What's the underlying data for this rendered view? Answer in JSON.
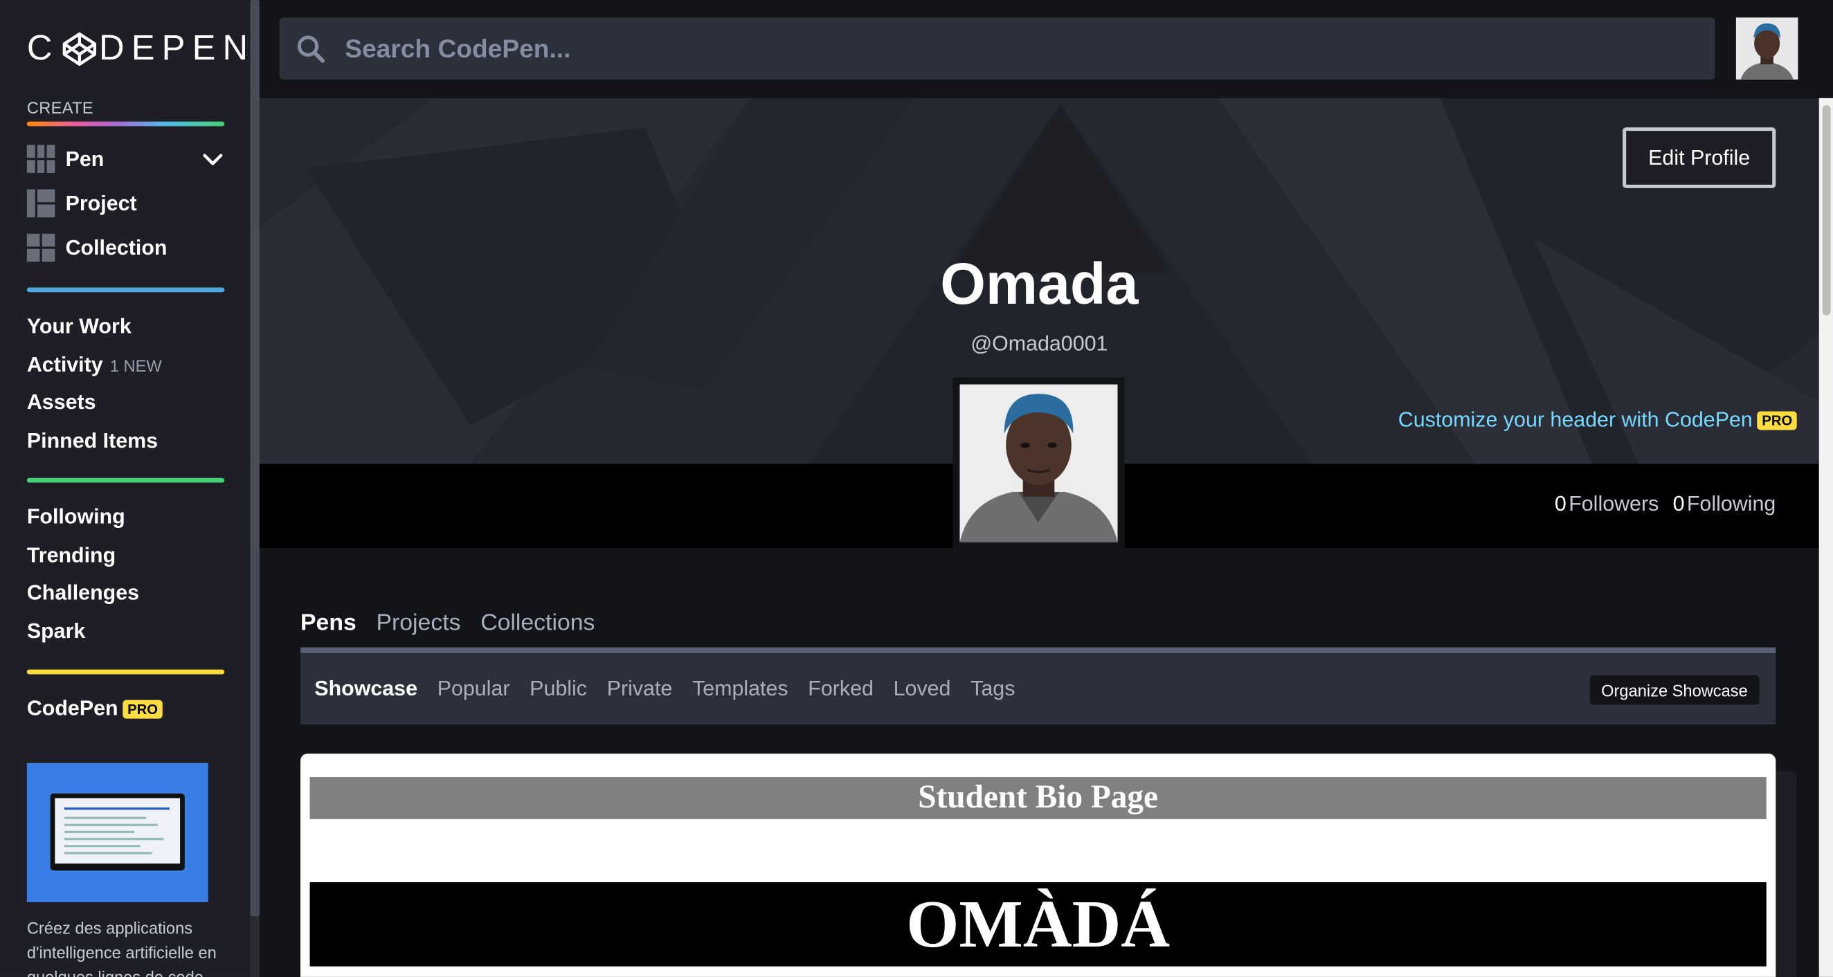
{
  "app": {
    "logo_text": "CODEPEN",
    "logo_left": "C",
    "logo_right": "DEPEN"
  },
  "sidebar": {
    "create_label": "CREATE",
    "create_items": [
      {
        "label": "Pen",
        "icon": "pen-icon"
      },
      {
        "label": "Project",
        "icon": "project-icon"
      },
      {
        "label": "Collection",
        "icon": "collection-icon"
      }
    ],
    "nav_group_1": [
      {
        "label": "Your Work"
      },
      {
        "label": "Activity",
        "badge": "1 NEW"
      },
      {
        "label": "Assets"
      },
      {
        "label": "Pinned Items"
      }
    ],
    "nav_group_2": [
      {
        "label": "Following"
      },
      {
        "label": "Trending"
      },
      {
        "label": "Challenges"
      },
      {
        "label": "Spark"
      }
    ],
    "codepen_pro": {
      "label": "CodePen",
      "badge": "PRO"
    },
    "ad": {
      "text": "Créez des applications d'intelligence artificielle en quelques lignes de code."
    }
  },
  "search": {
    "placeholder": "Search CodePen..."
  },
  "profile": {
    "name": "Omada",
    "handle": "@Omada0001",
    "edit_label": "Edit Profile",
    "customize_label": "Customize your header with CodePen",
    "customize_badge": "PRO",
    "followers_count": "0",
    "followers_label": "Followers",
    "following_count": "0",
    "following_label": "Following"
  },
  "tabs": [
    {
      "label": "Pens",
      "active": true
    },
    {
      "label": "Projects",
      "active": false
    },
    {
      "label": "Collections",
      "active": false
    }
  ],
  "subtabs": [
    {
      "label": "Showcase",
      "active": true
    },
    {
      "label": "Popular"
    },
    {
      "label": "Public"
    },
    {
      "label": "Private"
    },
    {
      "label": "Templates"
    },
    {
      "label": "Forked"
    },
    {
      "label": "Loved"
    },
    {
      "label": "Tags"
    }
  ],
  "organize_label": "Organize Showcase",
  "pen_preview": {
    "title_bar": "Student Bio Page",
    "name_bar": "OMÀDÁ"
  },
  "colors": {
    "accent_link": "#76daff",
    "pro_badge": "#ffdd40",
    "sidebar_bg": "#1e1f26",
    "page_bg": "#131417"
  }
}
